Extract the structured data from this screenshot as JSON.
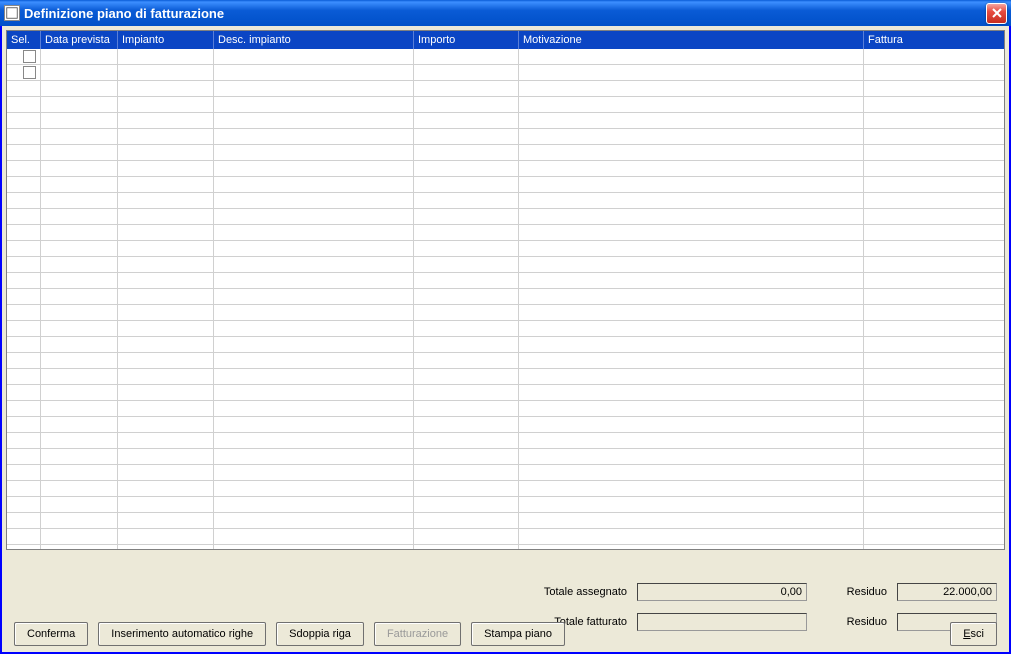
{
  "window": {
    "title": "Definizione piano di fatturazione"
  },
  "grid": {
    "columns": {
      "sel": "Sel.",
      "data_prevista": "Data prevista",
      "impianto": "Impianto",
      "desc_impianto": "Desc. impianto",
      "importo": "Importo",
      "motivazione": "Motivazione",
      "fattura": "Fattura"
    },
    "rows": [
      {
        "sel": false,
        "data_prevista": "",
        "impianto": "",
        "desc_impianto": "",
        "importo": "",
        "motivazione": "",
        "fattura": ""
      },
      {
        "sel": false,
        "data_prevista": "",
        "impianto": "",
        "desc_impianto": "",
        "importo": "",
        "motivazione": "",
        "fattura": ""
      }
    ],
    "empty_row_count": 30
  },
  "totals": {
    "totale_assegnato_label": "Totale assegnato",
    "totale_assegnato_value": "0,00",
    "totale_fatturato_label": "Totale fatturato",
    "totale_fatturato_value": "",
    "residuo1_label": "Residuo",
    "residuo1_value": "22.000,00",
    "residuo2_label": "Residuo",
    "residuo2_value": ""
  },
  "buttons": {
    "conferma": "Conferma",
    "inserimento": "Inserimento automatico righe",
    "sdoppia": "Sdoppia riga",
    "fatturazione": "Fatturazione",
    "stampa": "Stampa piano",
    "esci_prefix": "E",
    "esci_suffix": "sci"
  }
}
